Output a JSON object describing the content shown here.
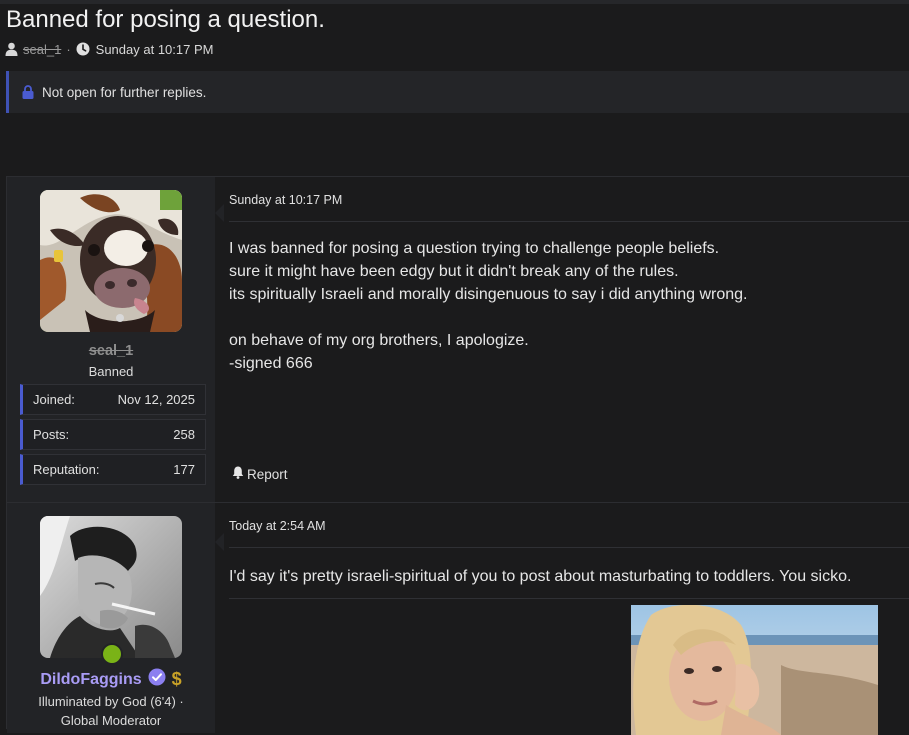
{
  "thread": {
    "title": "Banned for posing a question.",
    "author": "seal_1",
    "date": "Sunday at 10:17 PM",
    "notice": "Not open for further replies."
  },
  "posts": [
    {
      "user": {
        "name": "seal_1",
        "title": "Banned",
        "avatar_icon": "cow-avatar"
      },
      "stats": [
        {
          "label": "Joined:",
          "value": "Nov 12, 2025"
        },
        {
          "label": "Posts:",
          "value": "258"
        },
        {
          "label": "Reputation:",
          "value": "177"
        }
      ],
      "date": "Sunday at 10:17 PM",
      "lines": [
        "I was banned for posing a question trying to challenge people beliefs.",
        "sure it might have been edgy but it didn't break any of the rules.",
        "its spiritually Israeli and morally disingenuous to say i did anything wrong.",
        "",
        "on behave of my org brothers, I apologize.",
        "-signed 666"
      ],
      "report_label": "Report"
    },
    {
      "user": {
        "name": "DildoFaggins",
        "title_line1": "Illuminated by God (6'4) ·",
        "title_line2": "Global Moderator",
        "avatar_icon": "man-smoking-avatar",
        "online_color": "#7ab317",
        "name_color": "#a99cf5"
      },
      "date": "Today at 2:54 AM",
      "text": "I'd say it's pretty israeli-spiritual of you to post about masturbating to toddlers. You sicko.",
      "image_icon": "woman-beach-photo"
    }
  ],
  "colors": {
    "accent": "#4a5bd0",
    "background": "#1b1b1c",
    "panel": "#222326"
  }
}
